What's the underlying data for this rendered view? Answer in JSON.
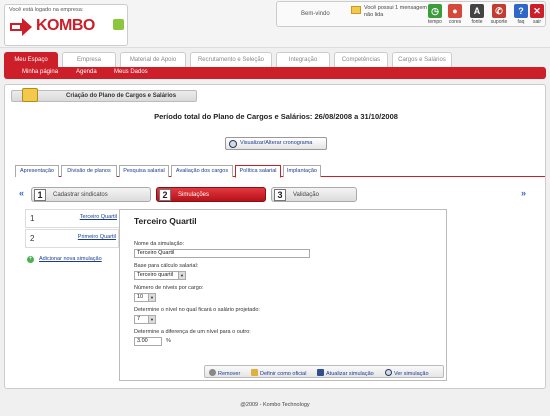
{
  "header": {
    "logo_caption": "Você está logado na empresa:",
    "logo_text": "KOMBO",
    "welcome": "Bem-vindo",
    "messages": "Você possui 1 mensagem não lida",
    "tools": [
      {
        "label": "tempo",
        "icon": "clock-icon",
        "color": "#3a9d3a"
      },
      {
        "label": "cores",
        "icon": "palette-icon",
        "color": "#d4493a"
      },
      {
        "label": "fonte",
        "icon": "font-icon",
        "color": "#444444"
      },
      {
        "label": "suporte",
        "icon": "support-icon",
        "color": "#c23c2f"
      },
      {
        "label": "faq",
        "icon": "faq-icon",
        "color": "#2e67c7"
      },
      {
        "label": "sair",
        "icon": "exit-icon",
        "color": "#cc1f2a"
      }
    ]
  },
  "nav": {
    "tabs": [
      "Meu Espaço",
      "Empresa",
      "Material de Apoio",
      "Recrutamento e Seleção",
      "Integração",
      "Competências",
      "Cargos e Salários"
    ],
    "active": 0,
    "subitems": [
      "Minha página",
      "Agenda",
      "Meus Dados"
    ]
  },
  "page": {
    "banner": "Criação do Plano de Cargos e Salários",
    "period": "Período total do Plano de Cargos e Salários: 26/08/2008 a 31/10/2008",
    "viz_button": "Visualizar/Alterar cronograma"
  },
  "tabs": [
    "Apresentação",
    "Divisão de planos",
    "Pesquisa salarial",
    "Avaliação dos cargos",
    "Política salarial",
    "Implantação"
  ],
  "active_tab": 4,
  "steps": [
    {
      "num": "1",
      "label": "Cadastrar sindicatos"
    },
    {
      "num": "2",
      "label": "Simulações"
    },
    {
      "num": "3",
      "label": "Validação"
    }
  ],
  "simulations": [
    {
      "num": "1",
      "label": "Terceiro Quartil"
    },
    {
      "num": "2",
      "label": "Primeiro Quartil"
    }
  ],
  "add_simulation": "Adicionar nova simulação",
  "form": {
    "title": "Terceiro Quartil",
    "name_label": "Nome da simulação:",
    "name_value": "Terceiro Quartil",
    "base_label": "Base para cálculo salarial:",
    "base_value": "Terceiro quartil",
    "levels_label": "Número de níveis por cargo:",
    "levels_value": "10",
    "projected_label": "Determine o nível no qual ficará o salário projetado:",
    "projected_value": "7",
    "diff_label": "Determine a diferença de um nível para o outro:",
    "diff_value": "3.00",
    "diff_unit": "%"
  },
  "actions": [
    "Remover",
    "Definir como oficial",
    "Atualizar simulação",
    "Ver simulação"
  ],
  "footer": "@2009 - Kombo Technology"
}
